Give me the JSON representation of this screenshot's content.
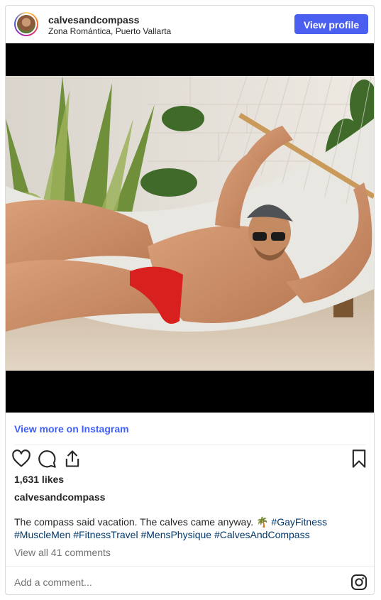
{
  "header": {
    "username": "calvesandcompass",
    "location": "Zona Romántica, Puerto Vallarta",
    "view_profile_label": "View profile"
  },
  "post": {
    "view_more_label": "View more on Instagram",
    "likes": "1,631 likes",
    "caption_user": "calvesandcompass",
    "caption_text": "The compass said vacation. The calves came anyway. 🌴",
    "hashtags": [
      "#GayFitness",
      "#MuscleMen",
      "#FitnessTravel",
      "#MensPhysique",
      "#CalvesAndCompass"
    ],
    "view_comments_label": "View all 41 comments",
    "add_comment_placeholder": "Add a comment..."
  },
  "icons": {
    "like": "heart-icon",
    "comment": "comment-icon",
    "share": "share-icon",
    "save": "bookmark-icon",
    "instagram": "instagram-logo-icon"
  },
  "colors": {
    "accent": "#4a5ff0",
    "link": "#3f5efb",
    "hashtag": "#00376b",
    "muted": "#737373"
  }
}
